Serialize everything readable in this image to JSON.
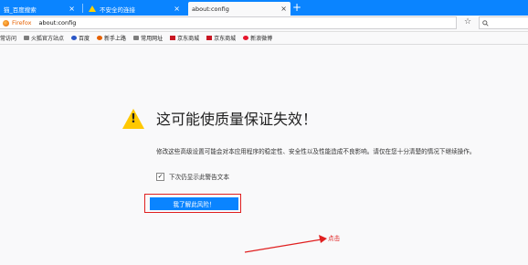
{
  "tabs": [
    {
      "title": "猫_百度搜索",
      "active": false
    },
    {
      "title": "不安全的连接",
      "active": false
    },
    {
      "title": "about:config",
      "active": true
    }
  ],
  "close_glyph": "×",
  "new_tab_glyph": "+",
  "urlbar": {
    "identity_label": "Firefox",
    "url": "about:config"
  },
  "search_box": {
    "icon": "search-icon"
  },
  "bookmarks": [
    {
      "label": "常访问",
      "icon": "folder-icon"
    },
    {
      "label": "火狐官方站点",
      "icon": "folder-icon"
    },
    {
      "label": "百度",
      "icon": "baidu-icon"
    },
    {
      "label": "新手上路",
      "icon": "firefox-icon"
    },
    {
      "label": "常用网址",
      "icon": "folder-icon"
    },
    {
      "label": "京东商城",
      "icon": "jd-icon"
    },
    {
      "label": "京东商城",
      "icon": "jd-icon"
    },
    {
      "label": "新浪微博",
      "icon": "weibo-icon"
    }
  ],
  "warning_page": {
    "title": "这可能使质量保证失效！",
    "description": "修改这些高级设置可能会对本应用程序的稳定性、安全性以及性能造成不良影响。请仅在您十分清楚的情况下继续操作。",
    "checkbox_label": "下次仍显示此警告文本",
    "checkbox_checked": true,
    "accept_button": "我了解此风险！"
  },
  "annotation": {
    "label": "点击",
    "color": "#e02020"
  },
  "colors": {
    "tab_bar": "#0a84ff",
    "accent": "#0a84ff",
    "warning": "#ffc800"
  }
}
